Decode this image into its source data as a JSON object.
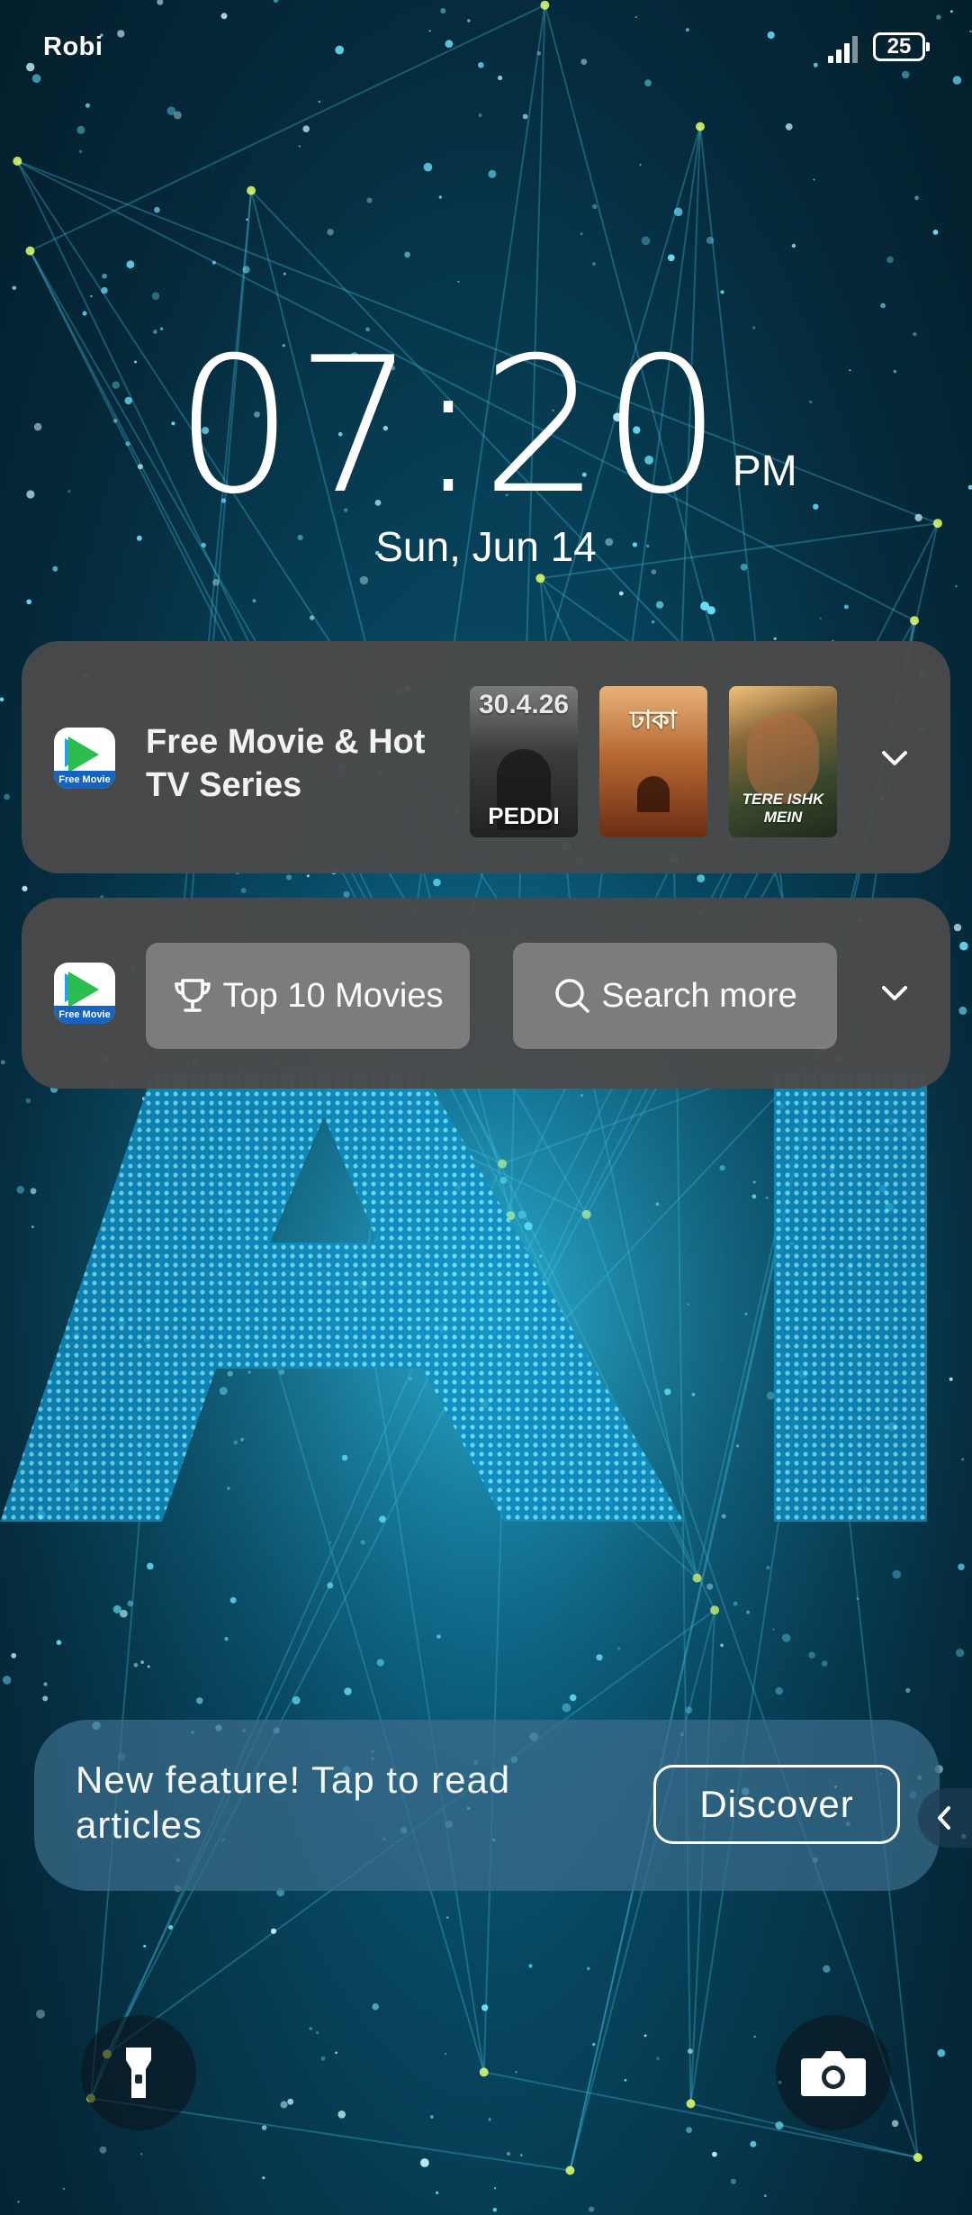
{
  "status_bar": {
    "carrier": "Robi",
    "battery_level": "25"
  },
  "clock": {
    "time": "07:20",
    "ampm": "PM",
    "date": "Sun, Jun 14"
  },
  "movie_widget": {
    "title": "Free Movie & Hot TV Series",
    "app_icon_text": "Free Movie",
    "posters": [
      {
        "top_text": "30.4.26",
        "bottom_text": "PEDDI"
      },
      {
        "top_text": "ঢাকা",
        "bottom_text": ""
      },
      {
        "top_text": "",
        "bottom_text": "TERE ISHK MEIN"
      }
    ]
  },
  "actions_widget": {
    "app_icon_text": "Free Movie",
    "top10_label": "Top 10 Movies",
    "search_label": "Search more"
  },
  "banner": {
    "text": "New feature! Tap to read articles",
    "button_label": "Discover"
  },
  "icons": {
    "signal": "signal-icon",
    "battery": "battery-icon",
    "chevron": "chevron-down-icon",
    "trophy": "trophy-icon",
    "search": "search-icon",
    "flashlight": "flashlight-icon",
    "camera": "camera-icon",
    "side_tab": "chevron-left-icon"
  },
  "colors": {
    "card_bg": "#4a4a4a",
    "button_bg": "#828282",
    "banner_bg": "#3c6e8c",
    "wallpaper_glow": "#2fd4ff"
  }
}
